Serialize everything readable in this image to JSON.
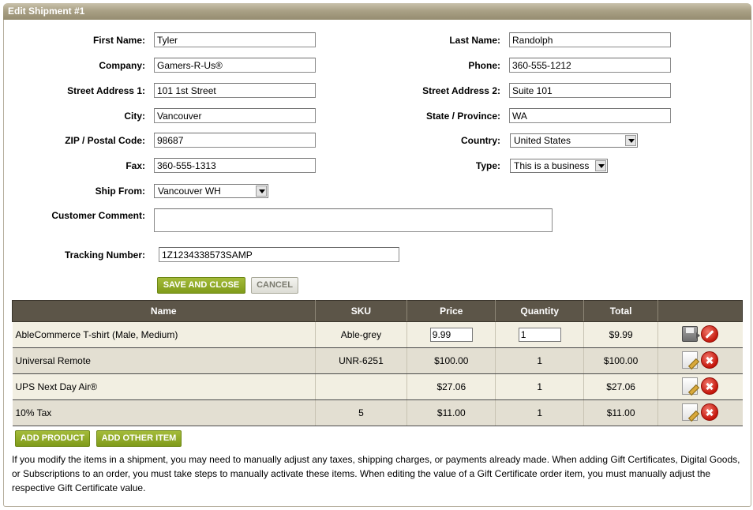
{
  "panel": {
    "title": "Edit Shipment #1"
  },
  "form": {
    "first_name": {
      "label": "First Name:",
      "value": "Tyler"
    },
    "last_name": {
      "label": "Last Name:",
      "value": "Randolph"
    },
    "company": {
      "label": "Company:",
      "value": "Gamers-R-Us®"
    },
    "phone": {
      "label": "Phone:",
      "value": "360-555-1212"
    },
    "street1": {
      "label": "Street Address 1:",
      "value": "101 1st Street"
    },
    "street2": {
      "label": "Street Address 2:",
      "value": "Suite 101"
    },
    "city": {
      "label": "City:",
      "value": "Vancouver"
    },
    "state": {
      "label": "State / Province:",
      "value": "WA"
    },
    "zip": {
      "label": "ZIP / Postal Code:",
      "value": "98687"
    },
    "country": {
      "label": "Country:",
      "value": "United States"
    },
    "fax": {
      "label": "Fax:",
      "value": "360-555-1313"
    },
    "type": {
      "label": "Type:",
      "value": "This is a business"
    },
    "ship_from": {
      "label": "Ship From:",
      "value": "Vancouver WH"
    },
    "customer_comment": {
      "label": "Customer Comment:",
      "value": ""
    },
    "tracking": {
      "label": "Tracking Number:",
      "value": "1Z1234338573SAMP"
    }
  },
  "buttons": {
    "save_close": "SAVE AND CLOSE",
    "cancel": "CANCEL",
    "add_product": "ADD PRODUCT",
    "add_other": "ADD OTHER ITEM"
  },
  "table": {
    "headers": [
      "Name",
      "SKU",
      "Price",
      "Quantity",
      "Total",
      ""
    ],
    "rows": [
      {
        "name": "AbleCommerce T-shirt (Male, Medium)",
        "sku": "Able-grey",
        "price": "9.99",
        "quantity": "1",
        "total": "$9.99",
        "editable": true
      },
      {
        "name": "Universal Remote",
        "sku": "UNR-6251",
        "price": "$100.00",
        "quantity": "1",
        "total": "$100.00",
        "editable": false
      },
      {
        "name": "UPS Next Day Air®",
        "sku": "",
        "price": "$27.06",
        "quantity": "1",
        "total": "$27.06",
        "editable": false
      },
      {
        "name": "10% Tax",
        "sku": "5",
        "price": "$11.00",
        "quantity": "1",
        "total": "$11.00",
        "editable": false
      }
    ]
  },
  "note": "If you modify the items in a shipment, you may need to manually adjust any taxes, shipping charges, or payments already made. When adding Gift Certificates, Digital Goods, or Subscriptions to an order, you must take steps to manually activate these items. When editing the value of a Gift Certificate order item, you must manually adjust the respective Gift Certificate value."
}
